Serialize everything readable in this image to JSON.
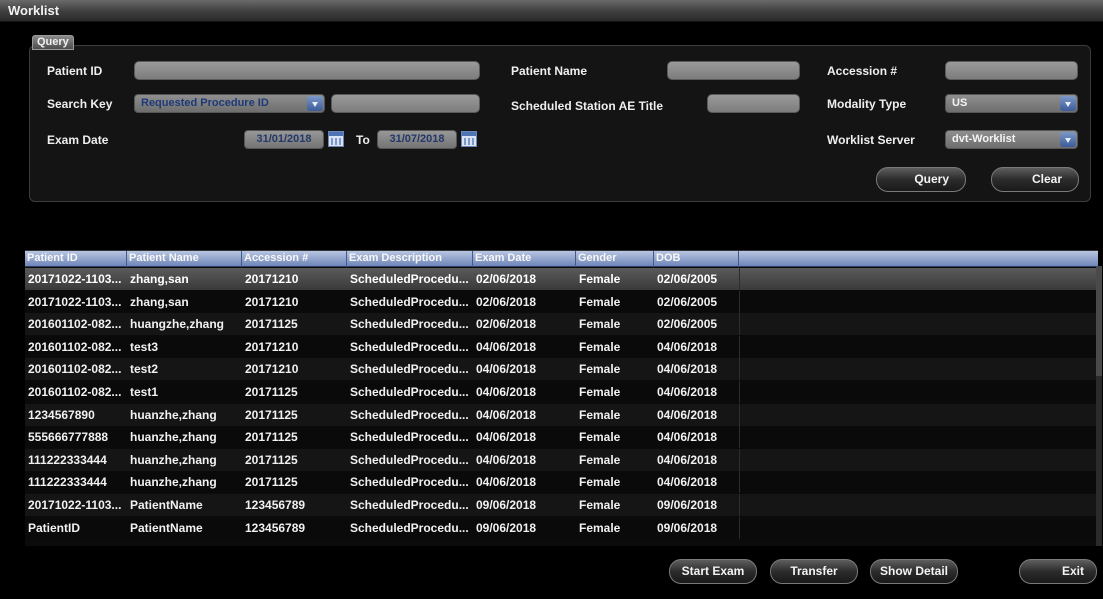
{
  "window": {
    "title": "Worklist"
  },
  "query": {
    "tab_label": "Query",
    "patient_id_label": "Patient ID",
    "patient_id_value": "",
    "patient_name_label": "Patient Name",
    "patient_name_value": "",
    "accession_label": "Accession #",
    "accession_value": "",
    "search_key_label": "Search Key",
    "search_key_value": "Requested Procedure ID",
    "search_key_input": "",
    "scheduled_ae_label": "Scheduled Station AE Title",
    "scheduled_ae_value": "",
    "modality_label": "Modality Type",
    "modality_value": "US",
    "exam_date_label": "Exam Date",
    "exam_date_from": "31/01/2018",
    "to_label": "To",
    "exam_date_to": "31/07/2018",
    "server_label": "Worklist Server",
    "server_value": "dvt-Worklist",
    "query_button": "Query",
    "clear_button": "Clear"
  },
  "table": {
    "columns": [
      "Patient ID",
      "Patient Name",
      "Accession #",
      "Exam Description",
      "Exam Date",
      "Gender",
      "DOB"
    ],
    "rows": [
      [
        "20171022-1103...",
        "zhang,san",
        "20171210",
        "ScheduledProcedu...",
        "02/06/2018",
        "Female",
        "02/06/2005"
      ],
      [
        "20171022-1103...",
        "zhang,san",
        "20171210",
        "ScheduledProcedu...",
        "02/06/2018",
        "Female",
        "02/06/2005"
      ],
      [
        "201601102-082...",
        "huangzhe,zhang",
        "20171125",
        "ScheduledProcedu...",
        "02/06/2018",
        "Female",
        "02/06/2005"
      ],
      [
        "201601102-082...",
        "test3",
        "20171210",
        "ScheduledProcedu...",
        "04/06/2018",
        "Female",
        "04/06/2018"
      ],
      [
        "201601102-082...",
        "test2",
        "20171210",
        "ScheduledProcedu...",
        "04/06/2018",
        "Female",
        "04/06/2018"
      ],
      [
        "201601102-082...",
        "test1",
        "20171125",
        "ScheduledProcedu...",
        "04/06/2018",
        "Female",
        "04/06/2018"
      ],
      [
        "1234567890",
        "huanzhe,zhang",
        "20171125",
        "ScheduledProcedu...",
        "04/06/2018",
        "Female",
        "04/06/2018"
      ],
      [
        "555666777888",
        "huanzhe,zhang",
        "20171125",
        "ScheduledProcedu...",
        "04/06/2018",
        "Female",
        "04/06/2018"
      ],
      [
        "111222333444",
        "huanzhe,zhang",
        "20171125",
        "ScheduledProcedu...",
        "04/06/2018",
        "Female",
        "04/06/2018"
      ],
      [
        "111222333444",
        "huanzhe,zhang",
        "20171125",
        "ScheduledProcedu...",
        "04/06/2018",
        "Female",
        "04/06/2018"
      ],
      [
        "20171022-1103...",
        "PatientName",
        "123456789",
        "ScheduledProcedu...",
        "09/06/2018",
        "Female",
        "09/06/2018"
      ],
      [
        "PatientID",
        "PatientName",
        "123456789",
        "ScheduledProcedu...",
        "09/06/2018",
        "Female",
        "09/06/2018"
      ]
    ]
  },
  "footer": {
    "start_exam": "Start Exam",
    "transfer": "Transfer",
    "show_detail": "Show Detail",
    "exit": "Exit"
  }
}
